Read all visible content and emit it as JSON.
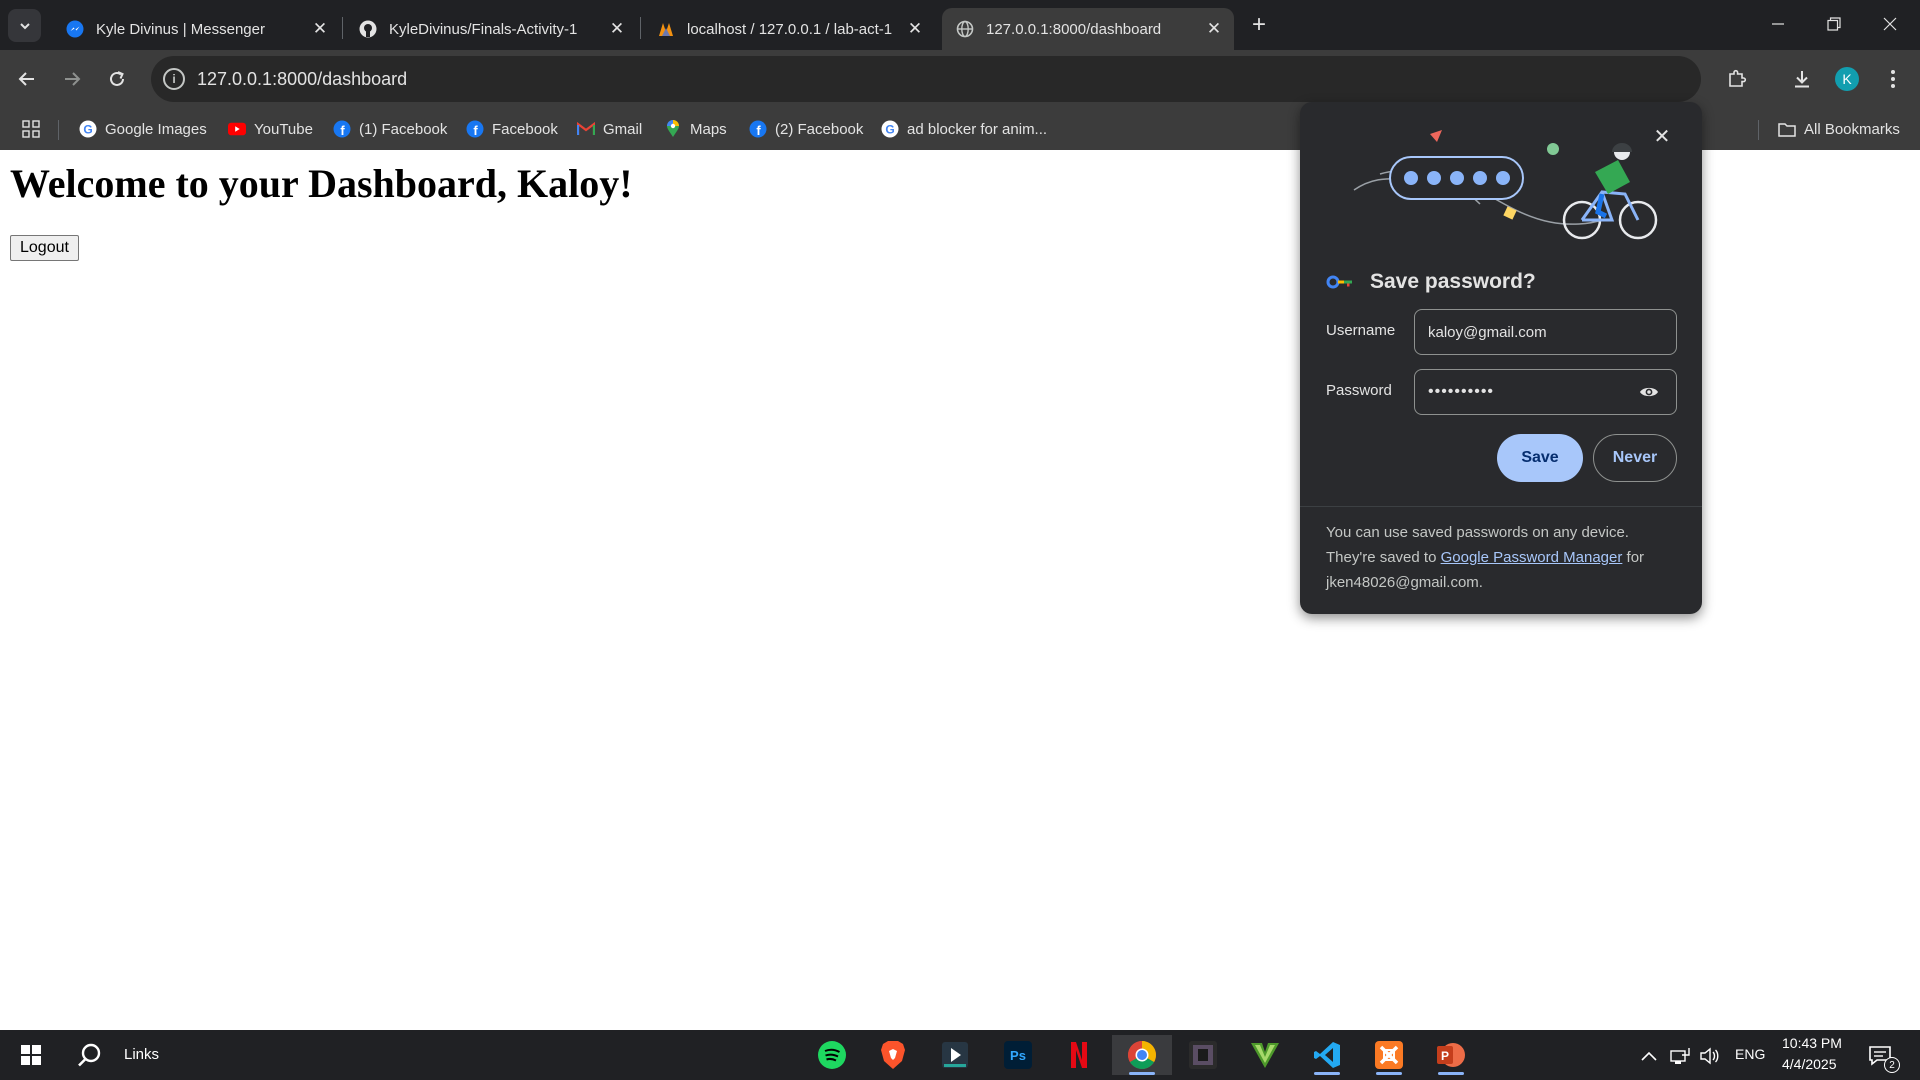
{
  "browser": {
    "tabs": [
      {
        "title": "Kyle Divinus | Messenger",
        "icon": "messenger-icon",
        "active": false
      },
      {
        "title": "KyleDivinus/Finals-Activity-1",
        "icon": "github-icon",
        "active": false
      },
      {
        "title": "localhost / 127.0.0.1 / lab-act-1",
        "icon": "phpmyadmin-icon",
        "active": false
      },
      {
        "title": "127.0.0.1:8000/dashboard",
        "icon": "globe-icon",
        "active": true
      }
    ],
    "url": "127.0.0.1:8000/dashboard",
    "profile_initial": "K",
    "bookmarks": [
      {
        "label": "Google Images",
        "icon": "google-icon"
      },
      {
        "label": "YouTube",
        "icon": "youtube-icon"
      },
      {
        "label": "(1) Facebook",
        "icon": "facebook-icon"
      },
      {
        "label": "Facebook",
        "icon": "facebook-icon"
      },
      {
        "label": "Gmail",
        "icon": "gmail-icon"
      },
      {
        "label": "Maps",
        "icon": "maps-icon"
      },
      {
        "label": "(2) Facebook",
        "icon": "facebook-icon"
      },
      {
        "label": "ad blocker for anim...",
        "icon": "google-icon"
      }
    ],
    "all_bookmarks_label": "All Bookmarks"
  },
  "page": {
    "heading": "Welcome to your Dashboard, Kaloy!",
    "logout_label": "Logout"
  },
  "password_prompt": {
    "title": "Save password?",
    "username_label": "Username",
    "username_value": "kaloy@gmail.com",
    "password_label": "Password",
    "password_masked": "••••••••••",
    "save_label": "Save",
    "never_label": "Never",
    "footer_text_1": "You can use saved passwords on any device. They're saved to ",
    "footer_link": "Google Password Manager",
    "footer_text_2": " for jken48026@gmail.com."
  },
  "taskbar": {
    "search_label": "Links",
    "language": "ENG",
    "time": "10:43 PM",
    "date": "4/4/2025",
    "notification_count": "2"
  },
  "colors": {
    "accent": "#a8c7fa",
    "tab_bg": "#202124",
    "toolbar_bg": "#3c3c3c"
  }
}
